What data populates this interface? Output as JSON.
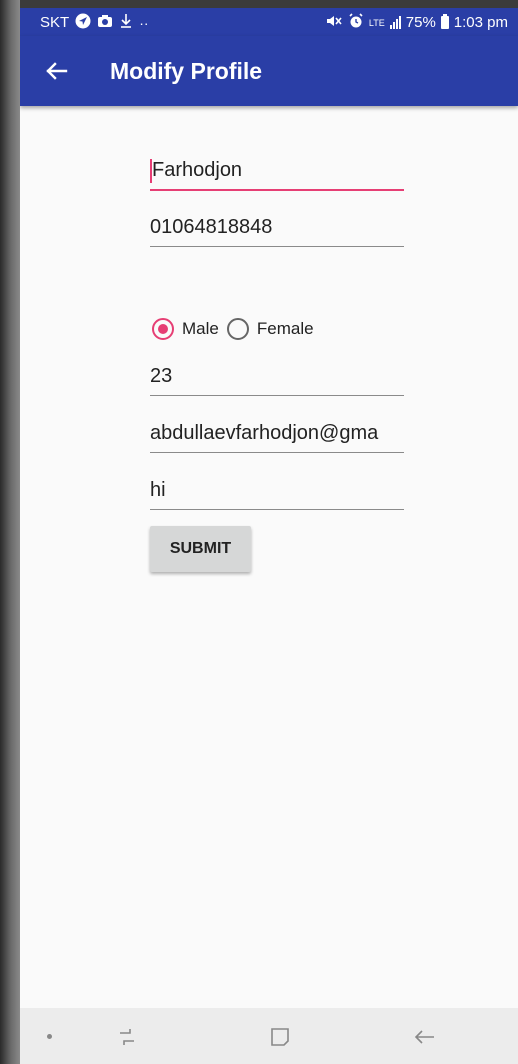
{
  "status_bar": {
    "carrier": "SKT",
    "network": "LTE",
    "battery": "75%",
    "time": "1:03 pm"
  },
  "app_bar": {
    "title": "Modify Profile",
    "back_icon": "arrow-back-icon",
    "color": "#2a3ea6"
  },
  "form": {
    "name": "Farhodjon",
    "phone": "01064818848",
    "gender": {
      "options": [
        "Male",
        "Female"
      ],
      "selected": "Male"
    },
    "age": "23",
    "email": "abdullaevfarhodjon@gma",
    "bio": "hi",
    "submit_label": "SUBMIT"
  },
  "accent_color": "#e63e74",
  "nav_bar": {
    "buttons": [
      "recent-apps-icon",
      "home-icon",
      "back-icon"
    ]
  }
}
